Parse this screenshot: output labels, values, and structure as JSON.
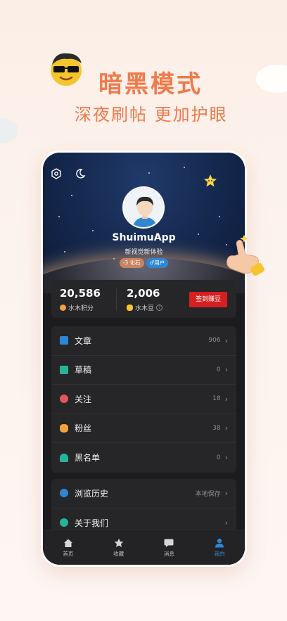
{
  "promo": {
    "title": "暗黑模式",
    "subtitle": "深夜刷帖 更加护眼"
  },
  "profile": {
    "username": "ShuimuApp",
    "bio": "新视觉新体验",
    "badges": [
      "-3 化石",
      "♂用户"
    ]
  },
  "stats": {
    "points_value": "20,586",
    "points_label": "水木积分",
    "beans_value": "2,006",
    "beans_label": "水木豆",
    "help_glyph": "?",
    "sign_button": "签到赚豆"
  },
  "menu_primary": [
    {
      "label": "文章",
      "value": "906",
      "icon": "article-icon",
      "color": "#2f87d4"
    },
    {
      "label": "草稿",
      "value": "0",
      "icon": "draft-icon",
      "color": "#27b39a"
    },
    {
      "label": "关注",
      "value": "18",
      "icon": "follow-icon",
      "color": "#e4565a"
    },
    {
      "label": "粉丝",
      "value": "38",
      "icon": "fans-icon",
      "color": "#f0a43a"
    },
    {
      "label": "黑名单",
      "value": "0",
      "icon": "blacklist-icon",
      "color": "#27b39a"
    }
  ],
  "menu_secondary": [
    {
      "label": "浏览历史",
      "value": "本地保存",
      "icon": "history-icon",
      "color": "#2f87d4"
    },
    {
      "label": "关于我们",
      "value": "",
      "icon": "info-icon",
      "color": "#27b39a"
    }
  ],
  "tabs": [
    {
      "label": "首页",
      "icon": "home-icon"
    },
    {
      "label": "收藏",
      "icon": "star-icon"
    },
    {
      "label": "消息",
      "icon": "message-icon"
    },
    {
      "label": "我的",
      "icon": "user-icon",
      "active": true
    }
  ],
  "chevron": "›",
  "colors": {
    "accent": "#ef7a4c",
    "primary_blue": "#2f87d4",
    "sign_red": "#d71f1f",
    "dark_bg": "#1c1c1e"
  }
}
